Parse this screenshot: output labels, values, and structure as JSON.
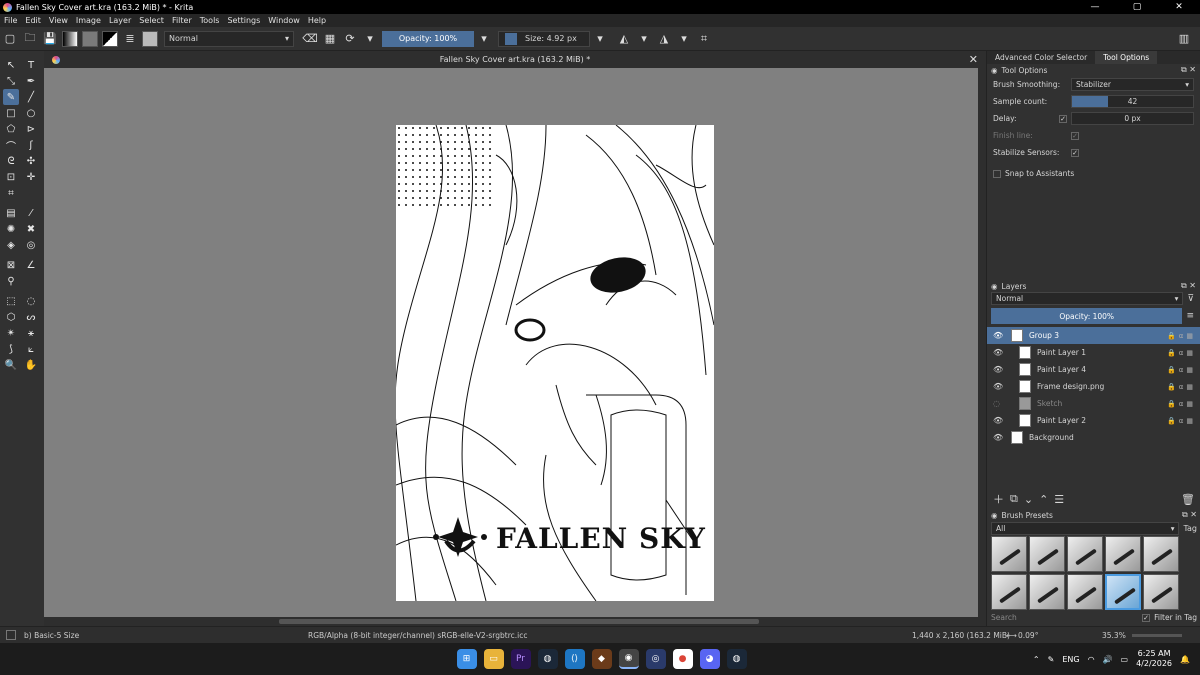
{
  "window": {
    "title": "Fallen Sky Cover art.kra (163.2 MiB) * - Krita",
    "minimize": "—",
    "maximize": "▢",
    "close": "✕"
  },
  "menu": [
    "File",
    "Edit",
    "View",
    "Image",
    "Layer",
    "Select",
    "Filter",
    "Tools",
    "Settings",
    "Window",
    "Help"
  ],
  "toolbar": {
    "blend_mode": "Normal",
    "opacity_label": "Opacity: 100%",
    "size_label": "Size: 4.92 px"
  },
  "document": {
    "tab_title": "Fallen Sky Cover art.kra (163.2 MiB) *",
    "logo_text": "FALLEN SKY"
  },
  "right_panel": {
    "tabs": [
      "Advanced Color Selector",
      "Tool Options"
    ],
    "tool_options": {
      "title": "Tool Options",
      "brush_smoothing_label": "Brush Smoothing:",
      "brush_smoothing_value": "Stabilizer",
      "sample_count_label": "Sample count:",
      "sample_count_value": "42",
      "sample_count_fraction": 0.3,
      "delay_label": "Delay:",
      "delay_value": "0 px",
      "finish_line_label": "Finish line:",
      "stabilize_sensors_label": "Stabilize Sensors:",
      "snap_label": "Snap to Assistants"
    },
    "layers": {
      "title": "Layers",
      "blend_mode": "Normal",
      "opacity_label": "Opacity:  100%",
      "items": [
        {
          "name": "Group 3",
          "selected": true
        },
        {
          "name": "Paint Layer 1",
          "selected": false
        },
        {
          "name": "Paint Layer 4",
          "selected": false
        },
        {
          "name": "Frame design.png",
          "selected": false
        },
        {
          "name": "Sketch",
          "selected": false,
          "hidden": true
        },
        {
          "name": "Paint Layer 2",
          "selected": false
        },
        {
          "name": "Background",
          "selected": false
        }
      ]
    },
    "brush_presets": {
      "title": "Brush Presets",
      "filter_value": "All",
      "tag_label": "Tag",
      "search_placeholder": "Search",
      "filter_in_tag_label": "Filter in Tag"
    }
  },
  "status": {
    "brush_name": "b) Basic-5 Size",
    "color_profile": "RGB/Alpha (8-bit integer/channel)  sRGB-elle-V2-srgbtrc.icc",
    "image_size": "1,440 x 2,160 (163.2 MiB)",
    "rotation": "0.09°",
    "zoom": "35.3%"
  },
  "taskbar": {
    "language": "ENG",
    "time": "6:25 AM",
    "date": "4/2/2026"
  }
}
